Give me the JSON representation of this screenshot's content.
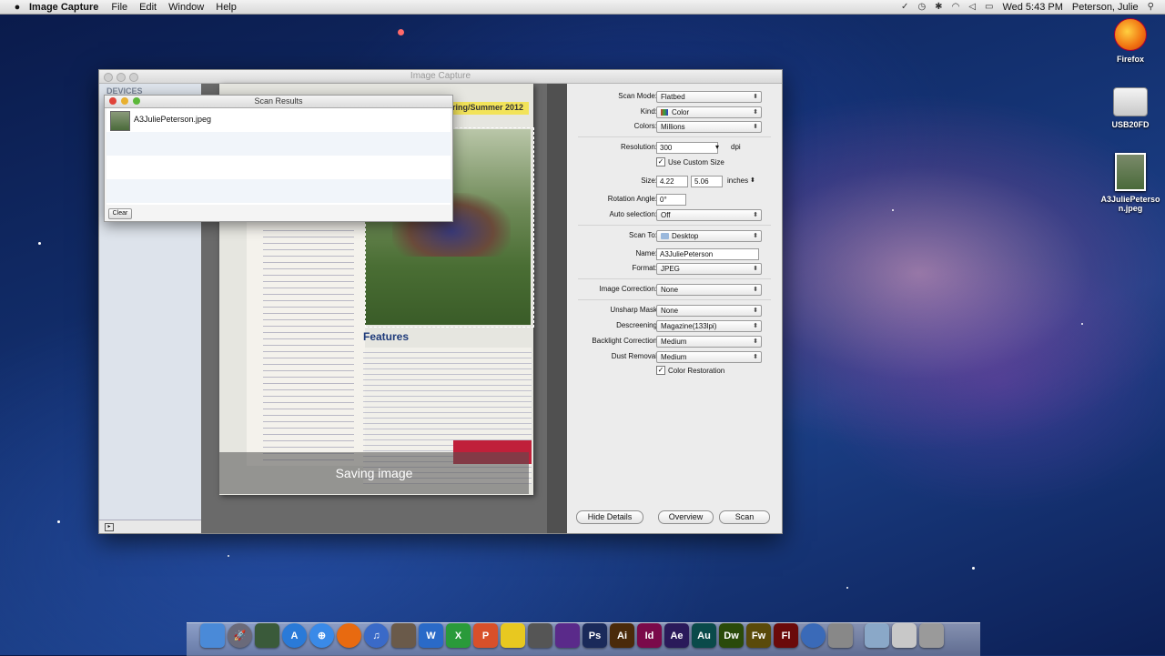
{
  "menubar": {
    "app_name": "Image Capture",
    "items": [
      "File",
      "Edit",
      "Window",
      "Help"
    ],
    "clock": "Wed 5:43 PM",
    "user": "Peterson, Julie"
  },
  "desktop_icons": [
    {
      "label": "Firefox"
    },
    {
      "label": "USB20FD"
    },
    {
      "label": "A3JuliePeterson.jpeg"
    }
  ],
  "window": {
    "title": "Image Capture",
    "sidebar_header": "DEVICES"
  },
  "preview": {
    "magazine_header": "Spring/Summer 2012",
    "features_title": "Features",
    "status": "Saving image"
  },
  "settings": {
    "scan_mode": {
      "label": "Scan Mode:",
      "value": "Flatbed"
    },
    "kind": {
      "label": "Kind:",
      "value": "Color"
    },
    "colors": {
      "label": "Colors:",
      "value": "Millions"
    },
    "resolution": {
      "label": "Resolution:",
      "value": "300",
      "unit": "dpi"
    },
    "use_custom_size": {
      "label": "Use Custom Size",
      "checked": true
    },
    "size": {
      "label": "Size:",
      "width": "4.22",
      "height": "5.06",
      "unit": "inches"
    },
    "rotation_angle": {
      "label": "Rotation Angle:",
      "value": "0°"
    },
    "auto_selection": {
      "label": "Auto selection:",
      "value": "Off"
    },
    "scan_to": {
      "label": "Scan To:",
      "value": "Desktop"
    },
    "name": {
      "label": "Name:",
      "value": "A3JuliePeterson"
    },
    "format": {
      "label": "Format:",
      "value": "JPEG"
    },
    "image_correction": {
      "label": "Image Correction:",
      "value": "None"
    },
    "unsharp_mask": {
      "label": "Unsharp Mask",
      "value": "None"
    },
    "descreening": {
      "label": "Descreening",
      "value": "Magazine(133lpi)"
    },
    "backlight_correction": {
      "label": "Backlight Correction",
      "value": "Medium"
    },
    "dust_removal": {
      "label": "Dust Removal",
      "value": "Medium"
    },
    "color_restoration": {
      "label": "Color Restoration",
      "checked": true
    }
  },
  "buttons": {
    "hide_details": "Hide Details",
    "overview": "Overview",
    "scan": "Scan"
  },
  "scan_results": {
    "title": "Scan Results",
    "files": [
      "A3JuliePeterson.jpeg"
    ],
    "clear_label": "Clear"
  },
  "dock": {
    "apps": [
      {
        "name": "Finder",
        "glyph": "",
        "color": "#4a8ad8"
      },
      {
        "name": "Launchpad",
        "glyph": "🚀",
        "color": "#6a6a7a"
      },
      {
        "name": "Mission Control",
        "glyph": "",
        "color": "#3a5a3a"
      },
      {
        "name": "App Store",
        "glyph": "A",
        "color": "#2a7ad8"
      },
      {
        "name": "Safari",
        "glyph": "⊕",
        "color": "#3a8ae8"
      },
      {
        "name": "Firefox",
        "glyph": "",
        "color": "#e86a10"
      },
      {
        "name": "iTunes",
        "glyph": "♫",
        "color": "#3a6ac8"
      },
      {
        "name": "iPhoto",
        "glyph": "",
        "color": "#6a5a4a"
      },
      {
        "name": "Word",
        "glyph": "W",
        "color": "#2a6ac8"
      },
      {
        "name": "Excel",
        "glyph": "X",
        "color": "#2a9a3a"
      },
      {
        "name": "PowerPoint",
        "glyph": "P",
        "color": "#d8502a"
      },
      {
        "name": "Adium",
        "glyph": "",
        "color": "#e8c820"
      },
      {
        "name": "Clapper",
        "glyph": "",
        "color": "#555"
      },
      {
        "name": "Media",
        "glyph": "",
        "color": "#5a2a8a"
      },
      {
        "name": "Photoshop",
        "glyph": "Ps",
        "color": "#1a2a5a"
      },
      {
        "name": "Illustrator",
        "glyph": "Ai",
        "color": "#4a2a0a"
      },
      {
        "name": "InDesign",
        "glyph": "Id",
        "color": "#7a0a4a"
      },
      {
        "name": "After Effects",
        "glyph": "Ae",
        "color": "#2a1a5a"
      },
      {
        "name": "Audition",
        "glyph": "Au",
        "color": "#0a4a4a"
      },
      {
        "name": "Dreamweaver",
        "glyph": "Dw",
        "color": "#2a4a0a"
      },
      {
        "name": "Fireworks",
        "glyph": "Fw",
        "color": "#5a4a0a"
      },
      {
        "name": "Flash",
        "glyph": "Fl",
        "color": "#6a0a0a"
      },
      {
        "name": "Network",
        "glyph": "",
        "color": "#3a6ab8"
      },
      {
        "name": "Image Capture",
        "glyph": "",
        "color": "#888"
      },
      {
        "name": "Folder",
        "glyph": "",
        "color": "#8aa8c8"
      },
      {
        "name": "Documents",
        "glyph": "",
        "color": "#c8c8c8"
      },
      {
        "name": "Trash",
        "glyph": "",
        "color": "#9a9a9a"
      }
    ]
  }
}
